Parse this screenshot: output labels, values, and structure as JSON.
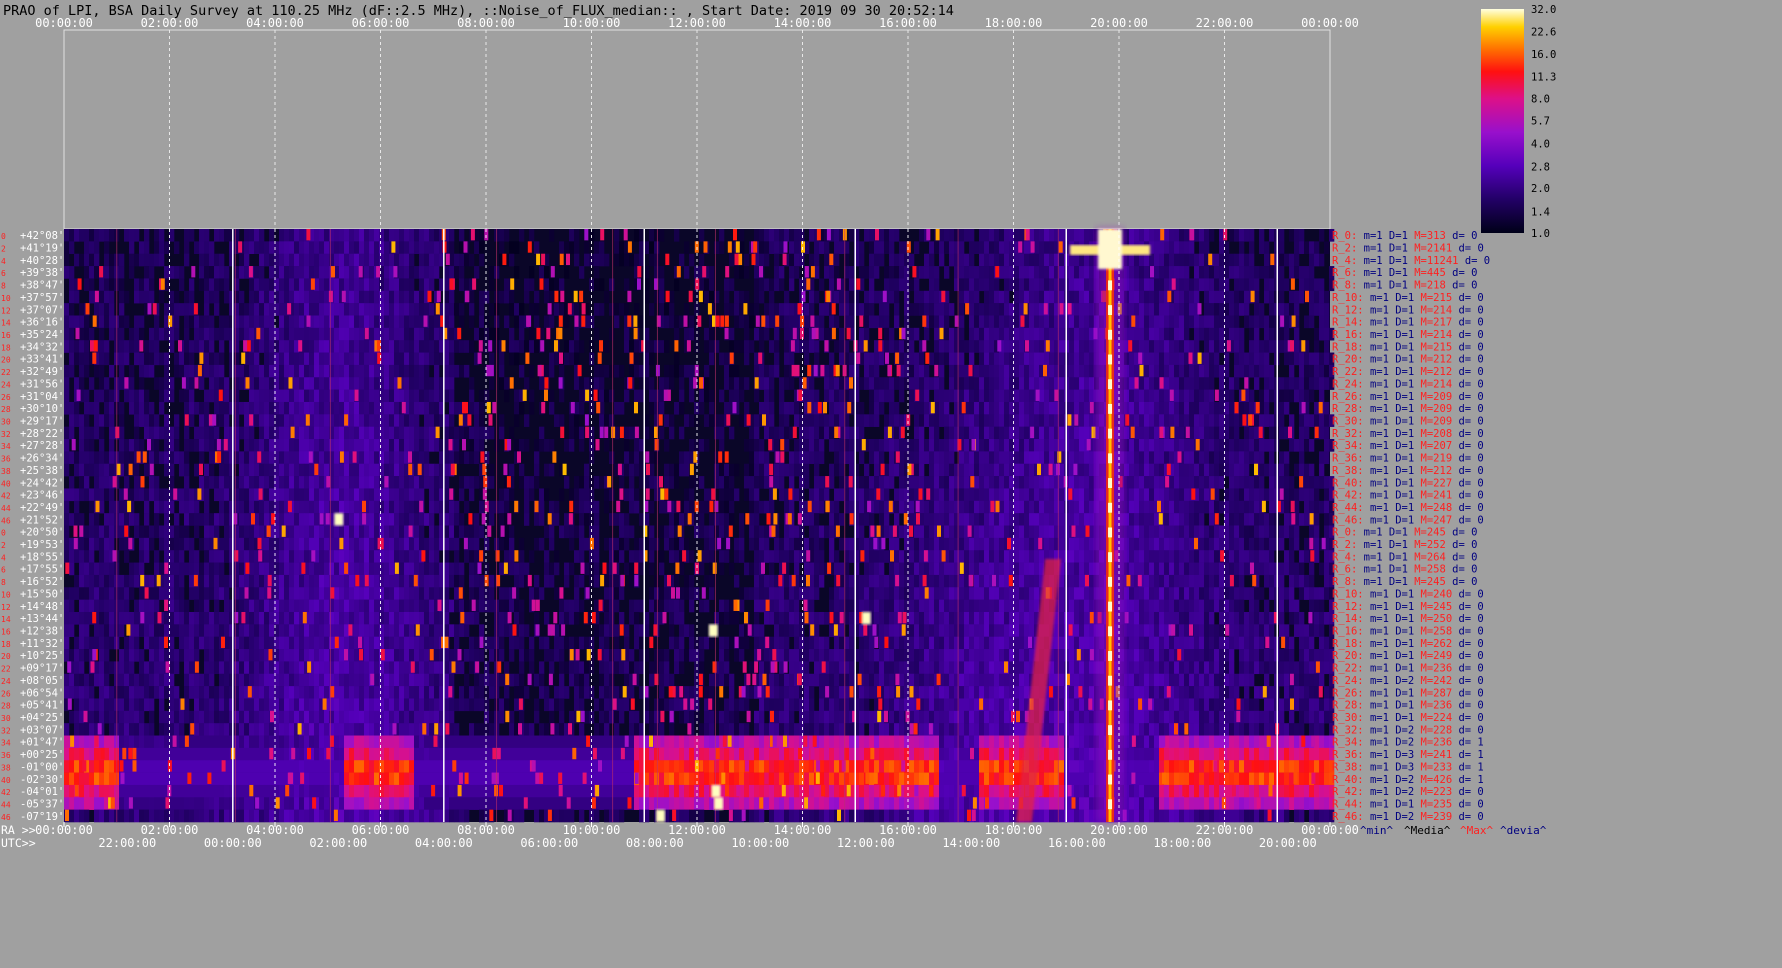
{
  "title": "PRAO of LPI, BSA Daily Survey at 110.25 MHz (dF::2.5 MHz), ::Noise_of_FLUX_median:: , Start Date: 2019 09 30 20:52:14",
  "chart_data": {
    "type": "heatmap",
    "title": "PRAO of LPI, BSA Daily Survey at 110.25 MHz (dF::2.5 MHz), ::Noise_of_FLUX_median:: , Start Date: 2019 09 30 20:52:14",
    "top_axis_labels": [
      "00:00:00",
      "02:00:00",
      "04:00:00",
      "06:00:00",
      "08:00:00",
      "10:00:00",
      "12:00:00",
      "14:00:00",
      "16:00:00",
      "18:00:00",
      "20:00:00",
      "22:00:00",
      "00:00:00"
    ],
    "ra_axis": {
      "prefix": "RA >>",
      "labels": [
        "00:00:00",
        "02:00:00",
        "04:00:00",
        "06:00:00",
        "08:00:00",
        "10:00:00",
        "12:00:00",
        "14:00:00",
        "16:00:00",
        "18:00:00",
        "20:00:00",
        "22:00:00",
        "00:00:00"
      ]
    },
    "utc_axis": {
      "prefix": "UTC>>",
      "labels": [
        "22:00:00",
        "00:00:00",
        "02:00:00",
        "04:00:00",
        "06:00:00",
        "08:00:00",
        "10:00:00",
        "12:00:00",
        "14:00:00",
        "16:00:00",
        "18:00:00",
        "20:00:00"
      ]
    },
    "row_numbers": [
      "0",
      "2",
      "4",
      "6",
      "8",
      "10",
      "12",
      "14",
      "16",
      "18",
      "20",
      "22",
      "24",
      "26",
      "28",
      "30",
      "32",
      "34",
      "36",
      "38",
      "40",
      "42",
      "44",
      "46",
      "0",
      "2",
      "4",
      "6",
      "8",
      "10",
      "12",
      "14",
      "16",
      "18",
      "20",
      "22",
      "24",
      "26",
      "28",
      "30",
      "32",
      "34",
      "36",
      "38",
      "40",
      "42",
      "44",
      "46"
    ],
    "declinations": [
      "+42°08'",
      "+41°19'",
      "+40°28'",
      "+39°38'",
      "+38°47'",
      "+37°57'",
      "+37°07'",
      "+36°16'",
      "+35°24'",
      "+34°32'",
      "+33°41'",
      "+32°49'",
      "+31°56'",
      "+31°04'",
      "+30°10'",
      "+29°17'",
      "+28°22'",
      "+27°28'",
      "+26°34'",
      "+25°38'",
      "+24°42'",
      "+23°46'",
      "+22°49'",
      "+21°52'",
      "+20°50'",
      "+19°53'",
      "+18°55'",
      "+17°55'",
      "+16°52'",
      "+15°50'",
      "+14°48'",
      "+13°44'",
      "+12°38'",
      "+11°32'",
      "+10°25'",
      "+09°17'",
      "+08°05'",
      "+06°54'",
      "+05°41'",
      "+04°25'",
      "+03°07'",
      "+01°47'",
      "+00°25'",
      "-01°00'",
      "-02°30'",
      "-04°01'",
      "-05°37'",
      "-07°19'"
    ],
    "beam_stats": [
      {
        "name": "R_0:",
        "m": "m=1",
        "D": "D=1",
        "M": "M=313",
        "d": "d= 0"
      },
      {
        "name": "R_2:",
        "m": "m=1",
        "D": "D=1",
        "M": "M=2141",
        "d": "d= 0"
      },
      {
        "name": "R_4:",
        "m": "m=1",
        "D": "D=1",
        "M": "M=11241",
        "d": "d= 0"
      },
      {
        "name": "R_6:",
        "m": "m=1",
        "D": "D=1",
        "M": "M=445",
        "d": "d= 0"
      },
      {
        "name": "R_8:",
        "m": "m=1",
        "D": "D=1",
        "M": "M=218",
        "d": "d= 0"
      },
      {
        "name": "R_10:",
        "m": "m=1",
        "D": "D=1",
        "M": "M=215",
        "d": "d= 0"
      },
      {
        "name": "R_12:",
        "m": "m=1",
        "D": "D=1",
        "M": "M=214",
        "d": "d= 0"
      },
      {
        "name": "R_14:",
        "m": "m=1",
        "D": "D=1",
        "M": "M=217",
        "d": "d= 0"
      },
      {
        "name": "R_16:",
        "m": "m=1",
        "D": "D=1",
        "M": "M=214",
        "d": "d= 0"
      },
      {
        "name": "R_18:",
        "m": "m=1",
        "D": "D=1",
        "M": "M=215",
        "d": "d= 0"
      },
      {
        "name": "R_20:",
        "m": "m=1",
        "D": "D=1",
        "M": "M=212",
        "d": "d= 0"
      },
      {
        "name": "R_22:",
        "m": "m=1",
        "D": "D=1",
        "M": "M=212",
        "d": "d= 0"
      },
      {
        "name": "R_24:",
        "m": "m=1",
        "D": "D=1",
        "M": "M=214",
        "d": "d= 0"
      },
      {
        "name": "R_26:",
        "m": "m=1",
        "D": "D=1",
        "M": "M=209",
        "d": "d= 0"
      },
      {
        "name": "R_28:",
        "m": "m=1",
        "D": "D=1",
        "M": "M=209",
        "d": "d= 0"
      },
      {
        "name": "R_30:",
        "m": "m=1",
        "D": "D=1",
        "M": "M=209",
        "d": "d= 0"
      },
      {
        "name": "R_32:",
        "m": "m=1",
        "D": "D=1",
        "M": "M=208",
        "d": "d= 0"
      },
      {
        "name": "R_34:",
        "m": "m=1",
        "D": "D=1",
        "M": "M=207",
        "d": "d= 0"
      },
      {
        "name": "R_36:",
        "m": "m=1",
        "D": "D=1",
        "M": "M=219",
        "d": "d= 0"
      },
      {
        "name": "R_38:",
        "m": "m=1",
        "D": "D=1",
        "M": "M=212",
        "d": "d= 0"
      },
      {
        "name": "R_40:",
        "m": "m=1",
        "D": "D=1",
        "M": "M=227",
        "d": "d= 0"
      },
      {
        "name": "R_42:",
        "m": "m=1",
        "D": "D=1",
        "M": "M=241",
        "d": "d= 0"
      },
      {
        "name": "R_44:",
        "m": "m=1",
        "D": "D=1",
        "M": "M=248",
        "d": "d= 0"
      },
      {
        "name": "R_46:",
        "m": "m=1",
        "D": "D=1",
        "M": "M=247",
        "d": "d= 0"
      },
      {
        "name": "R_0:",
        "m": "m=1",
        "D": "D=1",
        "M": "M=245",
        "d": "d= 0"
      },
      {
        "name": "R_2:",
        "m": "m=1",
        "D": "D=1",
        "M": "M=252",
        "d": "d= 0"
      },
      {
        "name": "R_4:",
        "m": "m=1",
        "D": "D=1",
        "M": "M=264",
        "d": "d= 0"
      },
      {
        "name": "R_6:",
        "m": "m=1",
        "D": "D=1",
        "M": "M=258",
        "d": "d= 0"
      },
      {
        "name": "R_8:",
        "m": "m=1",
        "D": "D=1",
        "M": "M=245",
        "d": "d= 0"
      },
      {
        "name": "R_10:",
        "m": "m=1",
        "D": "D=1",
        "M": "M=240",
        "d": "d= 0"
      },
      {
        "name": "R_12:",
        "m": "m=1",
        "D": "D=1",
        "M": "M=245",
        "d": "d= 0"
      },
      {
        "name": "R_14:",
        "m": "m=1",
        "D": "D=1",
        "M": "M=250",
        "d": "d= 0"
      },
      {
        "name": "R_16:",
        "m": "m=1",
        "D": "D=1",
        "M": "M=258",
        "d": "d= 0"
      },
      {
        "name": "R_18:",
        "m": "m=1",
        "D": "D=1",
        "M": "M=262",
        "d": "d= 0"
      },
      {
        "name": "R_20:",
        "m": "m=1",
        "D": "D=1",
        "M": "M=249",
        "d": "d= 0"
      },
      {
        "name": "R_22:",
        "m": "m=1",
        "D": "D=1",
        "M": "M=236",
        "d": "d= 0"
      },
      {
        "name": "R_24:",
        "m": "m=1",
        "D": "D=2",
        "M": "M=242",
        "d": "d= 0"
      },
      {
        "name": "R_26:",
        "m": "m=1",
        "D": "D=1",
        "M": "M=287",
        "d": "d= 0"
      },
      {
        "name": "R_28:",
        "m": "m=1",
        "D": "D=1",
        "M": "M=236",
        "d": "d= 0"
      },
      {
        "name": "R_30:",
        "m": "m=1",
        "D": "D=1",
        "M": "M=224",
        "d": "d= 0"
      },
      {
        "name": "R_32:",
        "m": "m=1",
        "D": "D=2",
        "M": "M=228",
        "d": "d= 0"
      },
      {
        "name": "R_34:",
        "m": "m=1",
        "D": "D=2",
        "M": "M=236",
        "d": "d= 1"
      },
      {
        "name": "R_36:",
        "m": "m=1",
        "D": "D=3",
        "M": "M=241",
        "d": "d= 1"
      },
      {
        "name": "R_38:",
        "m": "m=1",
        "D": "D=3",
        "M": "M=233",
        "d": "d= 1"
      },
      {
        "name": "R_40:",
        "m": "m=1",
        "D": "D=2",
        "M": "M=426",
        "d": "d= 1"
      },
      {
        "name": "R_42:",
        "m": "m=1",
        "D": "D=2",
        "M": "M=223",
        "d": "d= 0"
      },
      {
        "name": "R_44:",
        "m": "m=1",
        "D": "D=1",
        "M": "M=235",
        "d": "d= 0"
      },
      {
        "name": "R_46:",
        "m": "m=1",
        "D": "D=2",
        "M": "M=239",
        "d": "d= 0"
      }
    ],
    "stats_legend": [
      "^min^",
      "^Media^",
      "^Max^",
      "^devia^"
    ],
    "colorbar": {
      "labels": [
        "32.0",
        "22.6",
        "16.0",
        "11.3",
        "8.0",
        "5.7",
        "4.0",
        "2.8",
        "2.0",
        "1.4",
        "1.0"
      ],
      "values": [
        32.0,
        22.6,
        16.0,
        11.3,
        8.0,
        5.7,
        4.0,
        2.8,
        2.0,
        1.4,
        1.0
      ],
      "scale": "log"
    },
    "colors": {
      "background": "#a0a0a0",
      "plot_bg": "#0a0628",
      "stat_name": "#ff2020",
      "stat_value": "#000080",
      "stat_max": "#ff2020",
      "axis_text": "#ffffff",
      "title_text": "#000000",
      "row_number": "#ff2020",
      "declination": "#ffffff"
    },
    "features": [
      {
        "name": "bright source track",
        "ra": "19:50",
        "rows": "0-47"
      },
      {
        "name": "galactic plane band",
        "rows": "41-46"
      }
    ]
  }
}
